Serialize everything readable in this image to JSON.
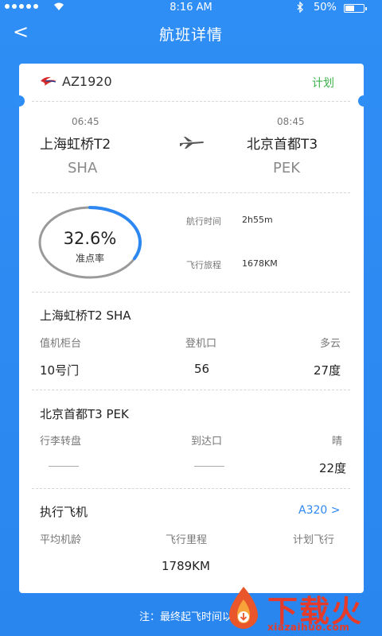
{
  "status_bar": {
    "time": "8:16 AM",
    "battery": "50%",
    "battery_fraction": 0.5
  },
  "nav": {
    "back_glyph": "<",
    "title": "航班详情"
  },
  "flight": {
    "number": "AZ1920",
    "status": "计划"
  },
  "departure": {
    "time": "06:45",
    "name": "上海虹桥T2",
    "code": "SHA"
  },
  "arrival": {
    "time": "08:45",
    "name": "北京首都T3",
    "code": "PEK"
  },
  "punctuality": {
    "value_text": "32.6%",
    "value": 0.326,
    "label": "准点率"
  },
  "stats": [
    {
      "label": "航行时间",
      "value": "2h55m"
    },
    {
      "label": "飞行旅程",
      "value": "1678KM"
    }
  ],
  "dep_airport": {
    "title": "上海虹桥T2 SHA",
    "labels": [
      "值机柜台",
      "登机口",
      "多云"
    ],
    "values": [
      "10号门",
      "56",
      "27度"
    ]
  },
  "arr_airport": {
    "title": "北京首都T3 PEK",
    "labels": [
      "行李转盘",
      "到达口",
      "晴"
    ],
    "values": [
      "",
      "",
      "22度"
    ]
  },
  "aircraft": {
    "title": "执行飞机",
    "model_link": "A320 >",
    "labels": [
      "平均机龄",
      "飞行里程",
      "计划飞行"
    ],
    "values": [
      "",
      "1789KM",
      ""
    ]
  },
  "footer_note": "注：最终起飞时间以机",
  "watermark": {
    "text": "下载火",
    "url": "xiazaihuo.com"
  },
  "colors": {
    "background": "#2f8ef5",
    "accent": "#2d87f0",
    "status_green": "#3bb14a",
    "brand_red": "#e43b2a"
  },
  "icons": [
    "wifi-icon",
    "bluetooth-icon",
    "battery-icon",
    "airline-logo-icon",
    "plane-icon",
    "watermark-flame-icon"
  ]
}
